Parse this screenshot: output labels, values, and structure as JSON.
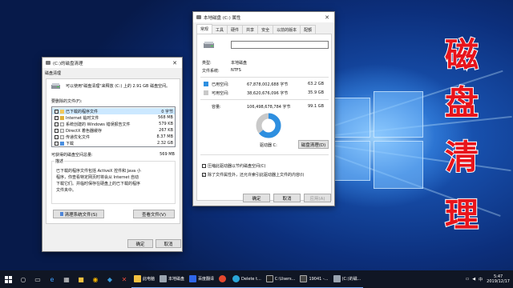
{
  "desktop": {
    "overlay_text": [
      "磁",
      "盘",
      "清",
      "理"
    ],
    "overlay_color": "#e8141b"
  },
  "cleanup_window": {
    "title": "(C:)的磁盘清理",
    "close_glyph": "✕",
    "section_label": "磁盘清理",
    "intro": "可以使用\"磁盘清理\"来释放 (C:) 上的 2.91 GB 磁盘空间。",
    "files_to_delete_label": "要删除的文件(F):",
    "files": [
      {
        "name": "已下载的程序文件",
        "size": "0 字节",
        "checked": true,
        "icon": "folder-icon"
      },
      {
        "name": "Internet 临时文件",
        "size": "568 MB",
        "checked": true,
        "icon": "lock-icon"
      },
      {
        "name": "系统创建的 Windows 错误报告文件",
        "size": "579 KB",
        "checked": false,
        "icon": "file-icon"
      },
      {
        "name": "DirectX 着色器缓存",
        "size": "267 KB",
        "checked": false,
        "icon": "file-icon"
      },
      {
        "name": "传递优化文件",
        "size": "8.37 MB",
        "checked": false,
        "icon": "file-icon"
      },
      {
        "name": "下载",
        "size": "2.32 GB",
        "checked": false,
        "icon": "download-icon"
      }
    ],
    "space_gained_label": "可获得的磁盘空间总量:",
    "space_gained_value": "569 MB",
    "description_label": "描述",
    "description_text": "已下载的程序文件包括 ActiveX 控件和 Java 小程序，你查看特定网页时将会从 Internet 自动下载它们。并临时保存在硬盘上的已下载的程序文件夹中。",
    "clean_system_button": "清理系统文件(S)",
    "view_files_button": "查看文件(V)",
    "ok_button": "确定",
    "cancel_button": "取消"
  },
  "properties_window": {
    "title": "本地磁盘 (C:) 属性",
    "close_glyph": "✕",
    "tabs": [
      "常规",
      "工具",
      "硬件",
      "共享",
      "安全",
      "以前的版本",
      "配额"
    ],
    "active_tab": 0,
    "drive_name_value": "",
    "type_label": "类型:",
    "type_value": "本地磁盘",
    "fs_label": "文件系统:",
    "fs_value": "NTFS",
    "used_label": "已用空间:",
    "used_bytes": "67,878,002,688 字节",
    "used_size": "63.2 GB",
    "used_color": "#2e8fe0",
    "free_label": "可用空间:",
    "free_bytes": "38,620,676,096 字节",
    "free_size": "35.9 GB",
    "free_color": "#c9c9c9",
    "capacity_label": "容量:",
    "capacity_bytes": "106,498,678,784 字节",
    "capacity_size": "99.1 GB",
    "used_fraction": 0.637,
    "drive_label": "驱动器 C:",
    "disk_cleanup_button": "磁盘清理(D)",
    "compress_label": "压缩此驱动器以节约磁盘空间(C)",
    "compress_checked": false,
    "index_label": "除了文件属性外，还允许索引此驱动器上文件的内容(I)",
    "index_checked": true,
    "ok_button": "确定",
    "cancel_button": "取消",
    "apply_button": "应用(A)"
  },
  "taskbar": {
    "apps": [
      {
        "label": "此电脑",
        "color": "#f3c141"
      },
      {
        "label": "本地磁盘",
        "color": "#9aa4b0"
      },
      {
        "label": "百度翻译",
        "color": "#2f66e8"
      },
      {
        "label": "",
        "color": "#e6482e"
      },
      {
        "label": "Delete t...",
        "color": "#2aa5d8"
      },
      {
        "label": "C:\\Users...",
        "color": "#222"
      },
      {
        "label": "19041 -...",
        "color": "#444"
      },
      {
        "label": "(C:)的磁...",
        "color": "#9aa4b0"
      }
    ],
    "tray_text": "中",
    "time": "5:47",
    "date": "2019/12/17"
  }
}
